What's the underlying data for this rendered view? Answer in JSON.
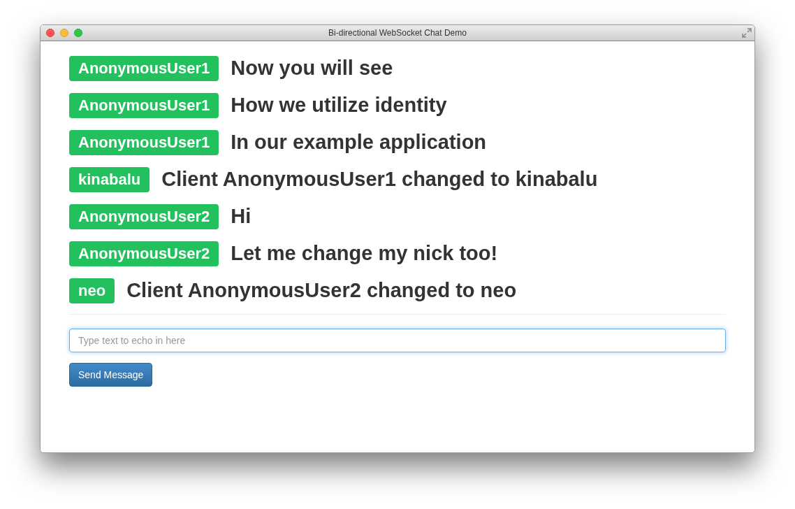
{
  "window": {
    "title": "Bi-directional WebSocket Chat Demo"
  },
  "messages": [
    {
      "user": "AnonymousUser1",
      "text": "Now you will see"
    },
    {
      "user": "AnonymousUser1",
      "text": "How we utilize identity"
    },
    {
      "user": "AnonymousUser1",
      "text": "In our example application"
    },
    {
      "user": "kinabalu",
      "text": "Client AnonymousUser1 changed to kinabalu"
    },
    {
      "user": "AnonymousUser2",
      "text": "Hi"
    },
    {
      "user": "AnonymousUser2",
      "text": "Let me change my nick too!"
    },
    {
      "user": "neo",
      "text": "Client AnonymousUser2 changed to neo"
    }
  ],
  "input": {
    "placeholder": "Type text to echo in here"
  },
  "send_button": {
    "label": "Send Message"
  }
}
